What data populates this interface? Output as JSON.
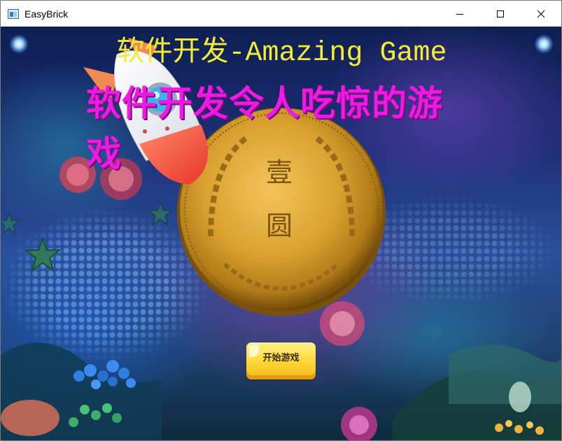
{
  "window": {
    "title": "EasyBrick",
    "controls": {
      "minimize_icon": "minimize-icon",
      "maximize_icon": "maximize-icon",
      "close_icon": "close-icon"
    }
  },
  "scene": {
    "headline_en": "软件开发-Amazing Game",
    "headline_cn": "软件开发令人吃惊的游戏",
    "coin_inscription_top": "壹",
    "coin_inscription_bottom": "圆",
    "start_button_label": "开始游戏"
  },
  "colors": {
    "headline_en": "#f4ec34",
    "headline_cn": "#ee19e2",
    "button_face": "#ffd93a",
    "button_shadow": "#e39a12",
    "coin_gold": "#d9a230"
  }
}
